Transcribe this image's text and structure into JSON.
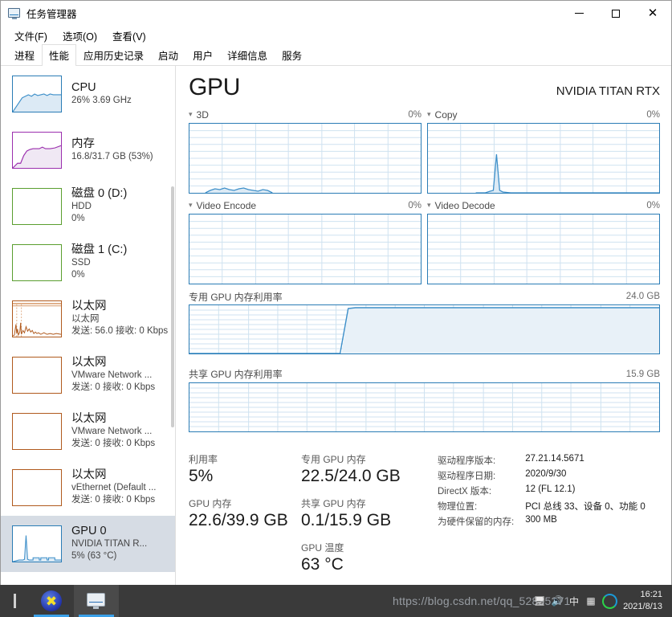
{
  "window": {
    "title": "任务管理器",
    "icon": "task-manager-icon",
    "minimize_label": "—",
    "maximize_label": "",
    "close_label": "✕"
  },
  "menu": [
    {
      "label": "文件(F)"
    },
    {
      "label": "选项(O)"
    },
    {
      "label": "查看(V)"
    }
  ],
  "tabs": [
    {
      "label": "进程",
      "active": false
    },
    {
      "label": "性能",
      "active": true
    },
    {
      "label": "应用历史记录",
      "active": false
    },
    {
      "label": "启动",
      "active": false
    },
    {
      "label": "用户",
      "active": false
    },
    {
      "label": "详细信息",
      "active": false
    },
    {
      "label": "服务",
      "active": false
    }
  ],
  "sidebar": {
    "items": [
      {
        "title": "CPU",
        "sub1": "26% 3.69 GHz",
        "sub2": "",
        "color": "#2a7cb5",
        "selected": false
      },
      {
        "title": "内存",
        "sub1": "16.8/31.7 GB (53%)",
        "sub2": "",
        "color": "#9b2fae",
        "selected": false
      },
      {
        "title": "磁盘 0 (D:)",
        "sub1": "HDD",
        "sub2": "0%",
        "color": "#5a9e2f",
        "selected": false
      },
      {
        "title": "磁盘 1 (C:)",
        "sub1": "SSD",
        "sub2": "0%",
        "color": "#5a9e2f",
        "selected": false
      },
      {
        "title": "以太网",
        "sub1": "以太网",
        "sub2": "发送: 56.0 接收: 0 Kbps",
        "color": "#b05a1e",
        "selected": false
      },
      {
        "title": "以太网",
        "sub1": "VMware Network ...",
        "sub2": "发送: 0 接收: 0 Kbps",
        "color": "#b05a1e",
        "selected": false
      },
      {
        "title": "以太网",
        "sub1": "VMware Network ...",
        "sub2": "发送: 0 接收: 0 Kbps",
        "color": "#b05a1e",
        "selected": false
      },
      {
        "title": "以太网",
        "sub1": "vEthernet (Default ...",
        "sub2": "发送: 0 接收: 0 Kbps",
        "color": "#b05a1e",
        "selected": false
      },
      {
        "title": "GPU 0",
        "sub1": "NVIDIA TITAN R...",
        "sub2": "5% (63 °C)",
        "color": "#2a7cb5",
        "selected": true
      }
    ]
  },
  "main": {
    "title": "GPU",
    "device": "NVIDIA TITAN RTX",
    "graphs": [
      {
        "name": "3D",
        "value": "0%"
      },
      {
        "name": "Copy",
        "value": "0%"
      },
      {
        "name": "Video Encode",
        "value": "0%"
      },
      {
        "name": "Video Decode",
        "value": "0%"
      }
    ],
    "memory_graphs": [
      {
        "name": "专用 GPU 内存利用率",
        "max": "24.0 GB"
      },
      {
        "name": "共享 GPU 内存利用率",
        "max": "15.9 GB"
      }
    ],
    "stats": {
      "utilization_label": "利用率",
      "utilization_value": "5%",
      "gpu_memory_label": "GPU 内存",
      "gpu_memory_value": "22.6/39.9 GB",
      "dedicated_label": "专用 GPU 内存",
      "dedicated_value": "22.5/24.0 GB",
      "shared_label": "共享 GPU 内存",
      "shared_value": "0.1/15.9 GB",
      "temp_label": "GPU 温度",
      "temp_value": "63 °C"
    },
    "info": [
      {
        "key": "驱动程序版本:",
        "value": "27.21.14.5671"
      },
      {
        "key": "驱动程序日期:",
        "value": "2020/9/30"
      },
      {
        "key": "DirectX 版本:",
        "value": "12 (FL 12.1)"
      },
      {
        "key": "物理位置:",
        "value": "PCI 总线 33、设备 0、功能 0"
      },
      {
        "key": "为硬件保留的内存:",
        "value": "300 MB"
      }
    ]
  },
  "taskbar": {
    "watermark": "https://blog.csdn.net/qq_52835271",
    "time": "16:21",
    "date": "2021/8/13",
    "ime_label": "中",
    "tray_icons": [
      "monitor-icon",
      "volume-icon",
      "ime-icon",
      "grid-icon",
      "sync-ring-icon"
    ]
  },
  "chart_data": [
    {
      "type": "line",
      "title": "3D",
      "ylim": [
        0,
        100
      ],
      "ylabel": "%",
      "grid": true,
      "values": [
        0,
        0,
        0,
        0,
        0,
        0,
        0,
        0,
        0,
        0,
        0,
        0,
        0,
        3,
        4,
        3,
        5,
        4,
        3,
        4,
        3,
        2,
        3,
        5,
        4,
        3,
        2,
        1,
        0,
        0,
        0,
        0,
        0,
        0,
        0,
        0,
        0,
        0,
        0,
        0,
        0,
        0,
        0,
        0,
        0,
        0,
        0,
        0,
        0,
        0,
        0,
        0,
        0,
        0,
        0,
        0,
        0,
        0,
        0,
        0
      ]
    },
    {
      "type": "line",
      "title": "Copy",
      "ylim": [
        0,
        100
      ],
      "ylabel": "%",
      "grid": true,
      "values": [
        0,
        0,
        0,
        0,
        0,
        0,
        0,
        0,
        0,
        0,
        0,
        0,
        0,
        0,
        0,
        0,
        1,
        2,
        55,
        1,
        1,
        0,
        0,
        0,
        0,
        0,
        0,
        0,
        0,
        0,
        0,
        0,
        0,
        0,
        0,
        0,
        0,
        0,
        0,
        0,
        0,
        0,
        0,
        0,
        0,
        0,
        0,
        0,
        0,
        0,
        0,
        0,
        0,
        0,
        0,
        0,
        0,
        0,
        0,
        0
      ]
    },
    {
      "type": "line",
      "title": "Video Encode",
      "ylim": [
        0,
        100
      ],
      "ylabel": "%",
      "grid": true,
      "values": [
        0,
        0,
        0,
        0,
        0,
        0,
        0,
        0,
        0,
        0,
        0,
        0,
        0,
        0,
        0,
        0,
        0,
        0,
        0,
        0,
        0,
        0,
        0,
        0,
        0,
        0,
        0,
        0,
        0,
        0,
        0,
        0,
        0,
        0,
        0,
        0,
        0,
        0,
        0,
        0,
        0,
        0,
        0,
        0,
        0,
        0,
        0,
        0,
        0,
        0,
        0,
        0,
        0,
        0,
        0,
        0,
        0,
        0,
        0,
        0
      ]
    },
    {
      "type": "line",
      "title": "Video Decode",
      "ylim": [
        0,
        100
      ],
      "ylabel": "%",
      "grid": true,
      "values": [
        0,
        0,
        0,
        0,
        0,
        0,
        0,
        0,
        0,
        0,
        0,
        0,
        0,
        0,
        0,
        0,
        0,
        0,
        0,
        0,
        0,
        0,
        0,
        0,
        0,
        0,
        0,
        0,
        0,
        0,
        0,
        0,
        0,
        0,
        0,
        0,
        0,
        0,
        0,
        0,
        0,
        0,
        0,
        0,
        0,
        0,
        0,
        0,
        0,
        0,
        0,
        0,
        0,
        0,
        0,
        0,
        0,
        0,
        0,
        0
      ]
    },
    {
      "type": "area",
      "title": "专用 GPU 内存利用率",
      "ylim": [
        0,
        24.0
      ],
      "ylabel": "GB",
      "grid": true,
      "values": [
        0,
        0,
        0,
        0,
        0,
        0,
        0,
        0,
        0,
        0,
        0,
        0,
        0,
        0,
        0,
        0,
        0,
        0,
        0,
        0,
        10,
        22.5,
        22.6,
        22.5,
        22.5,
        22.5,
        22.5,
        22.5,
        22.5,
        22.5,
        22.5,
        22.5,
        22.5,
        22.5,
        22.5,
        22.5,
        22.5,
        22.5,
        22.5,
        22.5,
        22.5,
        22.5,
        22.5,
        22.5,
        22.5,
        22.5,
        22.5,
        22.5,
        22.5,
        22.5,
        22.5,
        22.5,
        22.5,
        22.5,
        22.5,
        22.5,
        22.5,
        22.5,
        22.5,
        22.5
      ]
    },
    {
      "type": "area",
      "title": "共享 GPU 内存利用率",
      "ylim": [
        0,
        15.9
      ],
      "ylabel": "GB",
      "grid": true,
      "values": [
        0,
        0,
        0,
        0,
        0,
        0,
        0,
        0,
        0,
        0,
        0,
        0,
        0,
        0,
        0,
        0,
        0,
        0,
        0,
        0,
        0,
        0,
        0,
        0,
        0,
        0,
        0,
        0,
        0,
        0,
        0,
        0,
        0,
        0,
        0,
        0,
        0,
        0,
        0,
        0,
        0,
        0,
        0,
        0,
        0,
        0,
        0,
        0,
        0,
        0,
        0,
        0,
        0,
        0,
        0,
        0,
        0,
        0,
        0,
        0
      ]
    }
  ]
}
